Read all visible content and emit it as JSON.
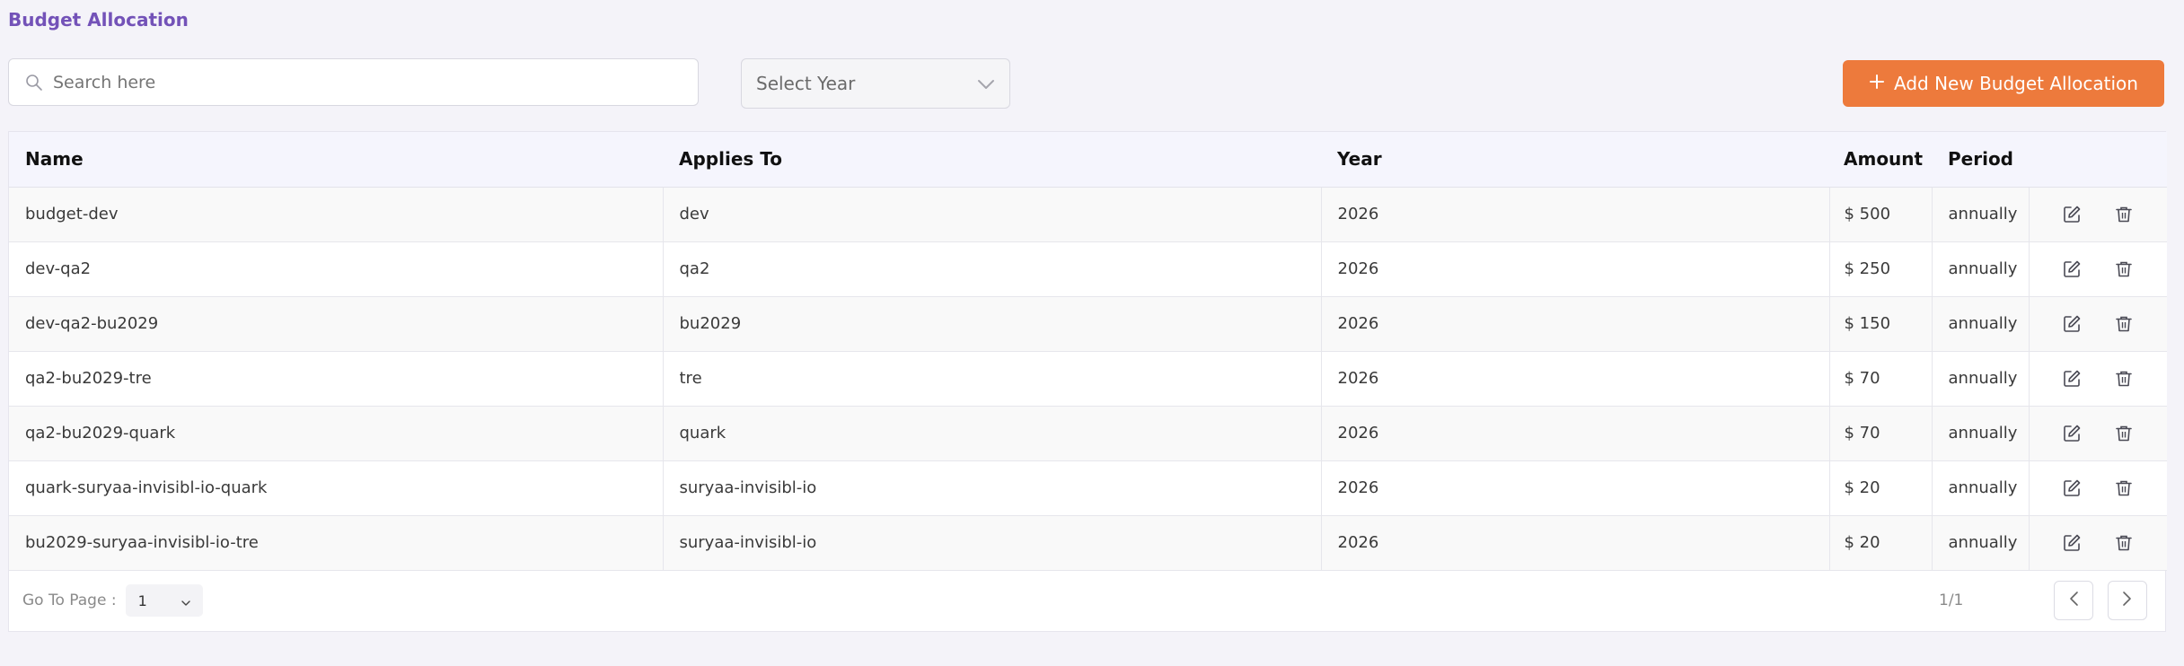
{
  "page": {
    "title": "Budget Allocation"
  },
  "search": {
    "placeholder": "Search here",
    "icon": "search-icon"
  },
  "year_filter": {
    "placeholder": "Select Year",
    "icon": "chevron-down-icon"
  },
  "add_button": {
    "label": "Add New Budget Allocation",
    "icon": "plus-icon",
    "color": "#ed7a3c"
  },
  "table": {
    "columns": {
      "name": "Name",
      "applies_to": "Applies To",
      "year": "Year",
      "amount": "Amount",
      "period": "Period"
    },
    "rows": [
      {
        "name": "budget-dev",
        "applies_to": "dev",
        "year": "2026",
        "amount": "$ 500",
        "period": "annually"
      },
      {
        "name": "dev-qa2",
        "applies_to": "qa2",
        "year": "2026",
        "amount": "$ 250",
        "period": "annually"
      },
      {
        "name": "dev-qa2-bu2029",
        "applies_to": "bu2029",
        "year": "2026",
        "amount": "$ 150",
        "period": "annually"
      },
      {
        "name": "qa2-bu2029-tre",
        "applies_to": "tre",
        "year": "2026",
        "amount": "$ 70",
        "period": "annually"
      },
      {
        "name": "qa2-bu2029-quark",
        "applies_to": "quark",
        "year": "2026",
        "amount": "$ 70",
        "period": "annually"
      },
      {
        "name": "quark-suryaa-invisibl-io-quark",
        "applies_to": "suryaa-invisibl-io",
        "year": "2026",
        "amount": "$ 20",
        "period": "annually"
      },
      {
        "name": "bu2029-suryaa-invisibl-io-tre",
        "applies_to": "suryaa-invisibl-io",
        "year": "2026",
        "amount": "$ 20",
        "period": "annually"
      }
    ],
    "row_actions": [
      "edit-icon",
      "trash-icon"
    ]
  },
  "pagination": {
    "goto_label": "Go To Page :",
    "current_page": "1",
    "page_count": "1/1",
    "prev_icon": "chevron-left-icon",
    "next_icon": "chevron-right-icon"
  },
  "colors": {
    "accent": "#7352b8",
    "background": "#f4f3f9"
  }
}
